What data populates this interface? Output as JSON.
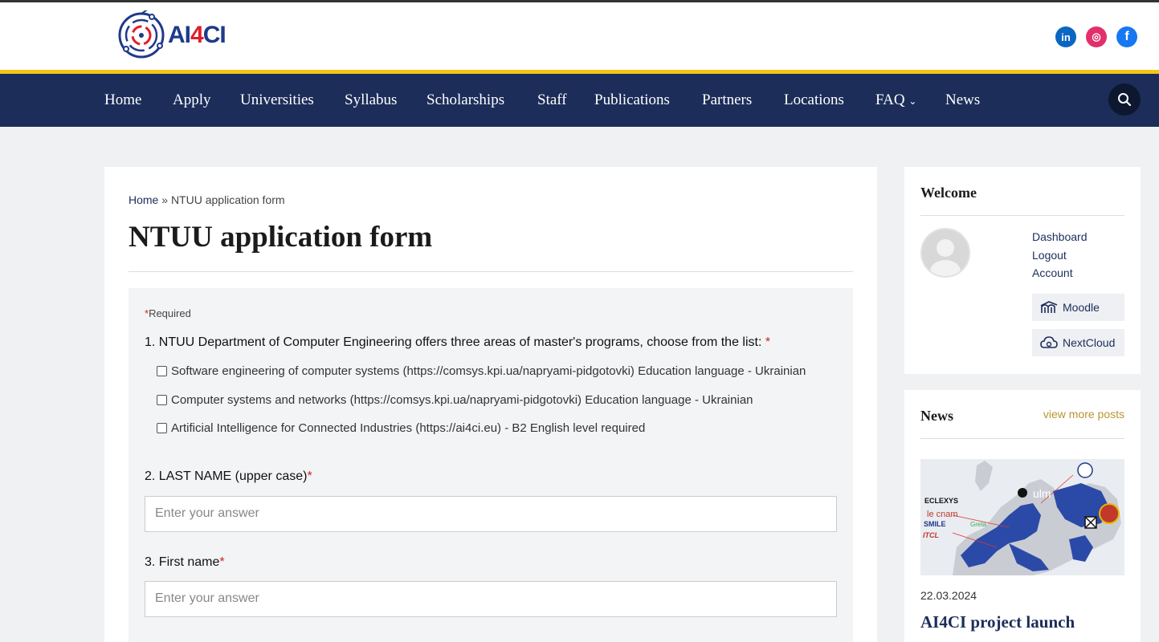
{
  "header": {
    "logo_text_a": "AI",
    "logo_text_b": "4",
    "logo_text_c": "CI",
    "social": [
      {
        "name": "linkedin",
        "glyph": "in",
        "color": "#0a66c2"
      },
      {
        "name": "instagram",
        "glyph": "◎",
        "color": "#e1306c"
      },
      {
        "name": "facebook",
        "glyph": "f",
        "color": "#1877f2"
      }
    ]
  },
  "nav": {
    "items": [
      "Home",
      "Apply",
      "Universities",
      "Syllabus",
      "Scholarships",
      "Staff",
      "Publications",
      "Partners",
      "Locations",
      "FAQ",
      "News"
    ],
    "faq_chevron": "⌄"
  },
  "main": {
    "breadcrumb_home": "Home",
    "breadcrumb_sep": " » ",
    "breadcrumb_current": "NTUU application form",
    "title": "NTUU application form"
  },
  "form": {
    "required_star": "*",
    "required_label": "Required",
    "q1": "1. NTUU Department of Computer Engineering offers three areas of master's programs, choose from the list:",
    "q1_options": [
      "Software engineering of computer systems (https://comsys.kpi.ua/napryami-pidgotovki) Education language - Ukrainian",
      "Computer systems and networks (https://comsys.kpi.ua/napryami-pidgotovki) Education language - Ukrainian",
      "Artificial Intelligence for Connected Industries (https://ai4ci.eu) - B2 English level required"
    ],
    "q2": "2. LAST NAME (upper case)",
    "q3": "3. First name",
    "answer_placeholder": "Enter your answer"
  },
  "sidebar": {
    "welcome_title": "Welcome",
    "links": [
      "Dashboard",
      "Logout",
      "Account"
    ],
    "moodle": "Moodle",
    "nextcloud": "NextCloud",
    "news_title": "News",
    "view_more": "view more posts",
    "news_date": "22.03.2024",
    "news_headline": "AI4CI project launch",
    "map_labels": [
      "ECLEXYS",
      "le cnam",
      "SMILE",
      "ulm",
      "Greta",
      "ITCL"
    ]
  },
  "colors": {
    "nav_bg": "#1c2d59",
    "accent_yellow": "#f5c518",
    "required_red": "#c62828",
    "link_gold": "#b8962e"
  }
}
